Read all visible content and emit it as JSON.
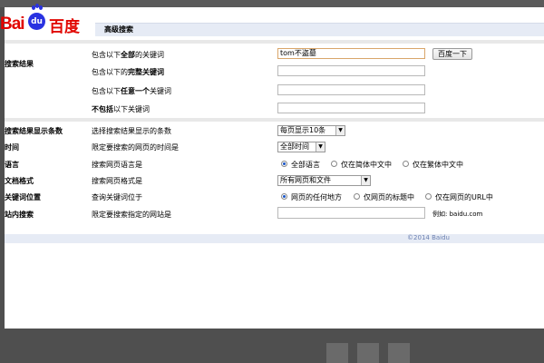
{
  "logo": {
    "bai": "Bai",
    "du": "du",
    "cn": "百度"
  },
  "header": {
    "title": "高级搜索"
  },
  "sections": {
    "search_results": "搜索结果",
    "results_count": "搜索结果显示条数",
    "time": "时间",
    "language": "语言",
    "doc_format": "文档格式",
    "keyword_position": "关键词位置",
    "site_search": "站内搜索"
  },
  "rows": {
    "all_words_pre": "包含以下",
    "all_words_bold": "全部",
    "all_words_post": "的关键词",
    "exact_pre": "包含以下的",
    "exact_bold": "完整关键词",
    "any_pre": "包含以下",
    "any_bold": "任意一个",
    "any_post": "关键词",
    "none_bold": "不包括",
    "none_post": "以下关键词",
    "results_desc": "选择搜索结果显示的条数",
    "time_desc": "限定要搜索的网页的时间是",
    "lang_desc": "搜索网页语言是",
    "format_desc": "搜索网页格式是",
    "position_desc": "查询关键词位于",
    "site_desc": "限定要搜索指定的网站是"
  },
  "inputs": {
    "all_words_value": "tom不盗墓",
    "exact_value": "",
    "any_value": "",
    "none_value": "",
    "site_value": ""
  },
  "search_button": "百度一下",
  "selects": {
    "results_per_page": "每页显示10条",
    "time": "全部时间",
    "format": "所有网页和文件"
  },
  "language_options": [
    "全部语言",
    "仅在简体中文中",
    "仅在繁体中文中"
  ],
  "position_options": [
    "网页的任何地方",
    "仅网页的标题中",
    "仅在网页的URL中"
  ],
  "site_example": "例如: baidu.com",
  "footer": "©2014 Baidu",
  "colors": {
    "brand_red": "#e10601",
    "brand_blue": "#2932e1",
    "header_bg": "#e6ebf5"
  }
}
